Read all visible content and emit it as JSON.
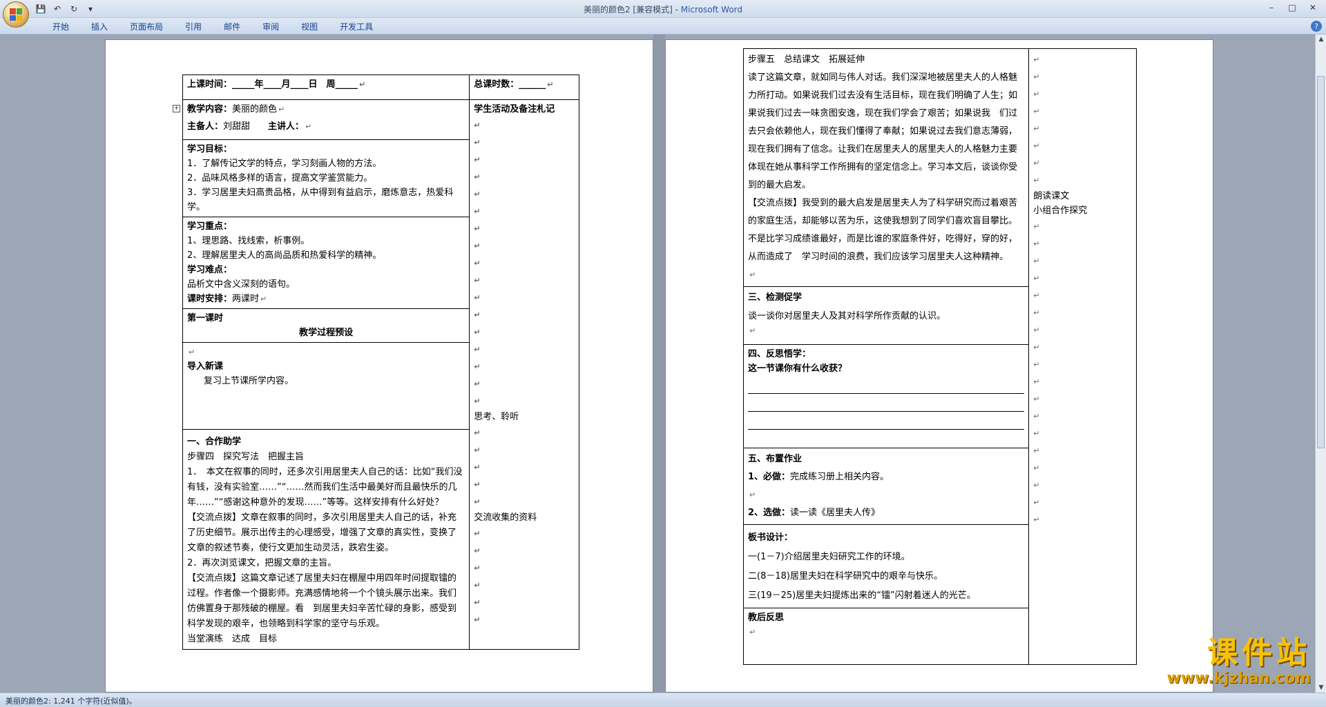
{
  "window": {
    "title_doc": "美丽的颜色2 [兼容模式] - ",
    "title_app": "Microsoft Word"
  },
  "qat": {
    "save_icon": "save-icon",
    "undo_icon": "undo-icon",
    "redo_icon": "redo-icon",
    "customize_icon": "chevron-down-icon"
  },
  "ribbon": {
    "tabs": [
      "开始",
      "插入",
      "页面布局",
      "引用",
      "邮件",
      "审阅",
      "视图",
      "开发工具"
    ],
    "help": "?"
  },
  "left_page": {
    "time_label": "上课时间：_____年____月____日　周_____",
    "total_label": "总课时数：______",
    "content_label": "教学内容：",
    "content_value": "美丽的颜色",
    "preparer_label": "主备人：",
    "preparer_value": "刘甜甜",
    "lecturer_label": "主讲人：",
    "student_col": "学生活动及备注札记",
    "goals_title": "学习目标：",
    "goals": [
      "1．了解传记文学的特点，学习刻画人物的方法。",
      "2．品味风格多样的语言，提高文学鉴赏能力。",
      "3．学习居里夫妇高贵品格，从中得到有益启示，磨炼意志，热爱科学。"
    ],
    "key_title": "学习重点：",
    "keys": [
      "1、理思路、找线索，析事例。",
      "2、理解居里夫人的高尚品质和热爱科学的精神。"
    ],
    "diff_title": "学习难点：",
    "diff_text": "品析文中含义深刻的语句。",
    "schedule_label": "课时安排：",
    "schedule_value": "两课时",
    "first_lesson": "第一课时",
    "process_title": "教学过程预设",
    "intro_title": "导入新课",
    "intro_text": "复习上节课所学内容。",
    "coop_title": "一、合作助学",
    "step4": "步骤四　探究写法　把握主旨",
    "q1": "1．　本文在叙事的同时，还多次引用居里夫人自己的话：比如“我们没有钱，没有实验室……”“……然而我们生活中最美好而且最快乐的几年……”“感谢这种意外的发现……”等等。这样安排有什么好处？",
    "exchange1": "【交流点拨】文章在叙事的同时，多次引用居里夫人自己的话，补充了历史细节。展示出传主的心理感受，增强了文章的真实性，变换了文章的叙述节奏，使行文更加生动灵活，跌宕生姿。",
    "q2": "2．再次浏览课文，把握文章的主旨。",
    "exchange2": "【交流点拨】这篇文章记述了居里夫妇在棚屋中用四年时间提取镭的过程。作者像一个摄影师。充满感情地将一个个镜头展示出来。我们仿佛置身于那残破的棚屋。看　到居里夫妇辛苦忙碌的身影，感受到科学发现的艰辛，也领略到科学家的坚守与乐观。",
    "practice": "当堂演练　达成　目标",
    "side_think": "思考、聆听",
    "side_share": "交流收集的资料"
  },
  "right_page": {
    "step5": "步骤五　总结课文　拓展延伸",
    "reading": "读了这篇文章，就如同与伟人对话。我们深深地被居里夫人的人格魅力所打动。如果说我们过去没有生活目标，现在我们明确了人生；如果说我们过去一味贪图安逸，现在我们学会了艰苦；如果说我　们过去只会依赖他人，现在我们懂得了奉献；如果说过去我们意志薄弱，现在我们拥有了信念。让我们在居里夫人的居里夫人的人格魅力主要体现在她从事科学工作所拥有的坚定信念上。学习本文后，谈谈你受到的最大启发。",
    "exchange": "【交流点拨】我受到的最大启发是居里夫人为了科学研究而过着艰苦的家庭生活，却能够以苦为乐，这使我想到了同学们喜欢盲目攀比。不是比学习成绩谁最好，而是比谁的家庭条件好，吃得好，穿的好，从而造成了　学习时间的浪费，我们应该学习居里夫人这种精神。",
    "side_read": "朗读课文",
    "side_group": "小组合作探究",
    "check_title": "三、检测促学",
    "check_text": "谈一谈你对居里夫人及其对科学所作贡献的认识。",
    "reflect_title": "四、反思悟学：",
    "reflect_q": "这一节课你有什么收获？",
    "hw_title": "五、布置作业",
    "hw1_label": "1、必做：",
    "hw1_text": "完成练习册上相关内容。",
    "hw2_label": "2、选做：",
    "hw2_text": "读一读《居里夫人传》",
    "board_title": "板书设计：",
    "board": [
      "一(1－7)介绍居里夫妇研究工作的环境。",
      "二(8－18)居里夫妇在科学研究中的艰辛与快乐。",
      "三(19－25)居里夫妇提炼出来的“镭”闪射着迷人的光芒。"
    ],
    "post_title": "教后反思"
  },
  "status": {
    "text": "美丽的颜色2: 1,241 个字符(近似值)。"
  },
  "watermark": {
    "line1": "课件站",
    "line2": "www.kjzhan.com"
  }
}
